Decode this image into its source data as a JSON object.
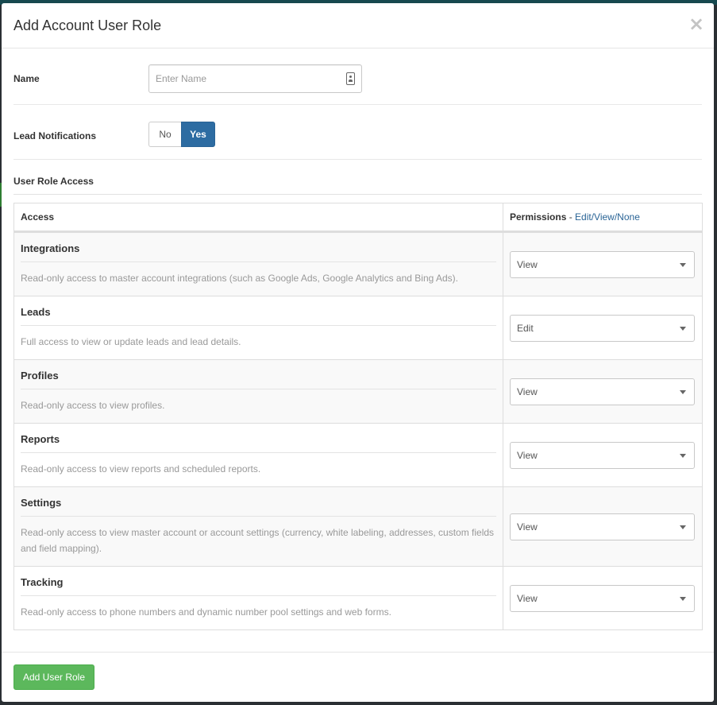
{
  "modal": {
    "title": "Add Account User Role",
    "close_symbol": "×"
  },
  "name_field": {
    "label": "Name",
    "placeholder": "Enter Name",
    "value": "",
    "icon": "contact-card-icon"
  },
  "lead_notifications": {
    "label": "Lead Notifications",
    "options": [
      "No",
      "Yes"
    ],
    "selected": "Yes"
  },
  "user_role_access": {
    "section_title": "User Role Access",
    "columns": {
      "access": "Access",
      "permissions": "Permissions",
      "separator": " - ",
      "hint": "Edit/View/None"
    },
    "rows": [
      {
        "name": "Integrations",
        "description": "Read-only access to master account integrations (such as Google Ads, Google Analytics and Bing Ads).",
        "permission": "View"
      },
      {
        "name": "Leads",
        "description": "Full access to view or update leads and lead details.",
        "permission": "Edit"
      },
      {
        "name": "Profiles",
        "description": "Read-only access to view profiles.",
        "permission": "View"
      },
      {
        "name": "Reports",
        "description": "Read-only access to view reports and scheduled reports.",
        "permission": "View"
      },
      {
        "name": "Settings",
        "description": "Read-only access to view master account or account settings (currency, white labeling, addresses, custom fields and field mapping).",
        "permission": "View"
      },
      {
        "name": "Tracking",
        "description": "Read-only access to phone numbers and dynamic number pool settings and web forms.",
        "permission": "View"
      }
    ]
  },
  "footer": {
    "submit_label": "Add User Role"
  },
  "colors": {
    "primary": "#2d6ca2",
    "success": "#5cb85c",
    "link": "#2a6496"
  }
}
